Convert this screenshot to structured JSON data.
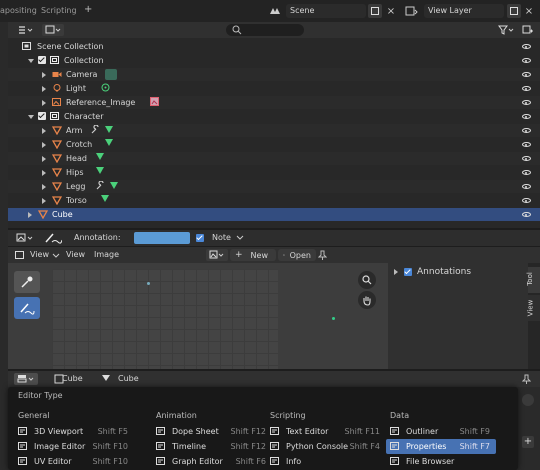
{
  "topbar": {
    "tabs": [
      "apositing",
      "Scripting"
    ],
    "add_tab": "+",
    "scene_name": "Scene",
    "view_layer": "View Layer"
  },
  "outliner": {
    "search_placeholder": "",
    "root": "Scene Collection",
    "rows": [
      {
        "label": "Collection",
        "indent": 1,
        "icon": "collection",
        "expanded": true,
        "checked": true
      },
      {
        "label": "Camera",
        "indent": 2,
        "icon": "camera",
        "extra": "camera-data"
      },
      {
        "label": "Light",
        "indent": 2,
        "icon": "light",
        "extra": "light-data"
      },
      {
        "label": "Reference_Image",
        "indent": 2,
        "icon": "image",
        "extra": "image-data"
      },
      {
        "label": "Character",
        "indent": 1,
        "icon": "collection",
        "expanded": true,
        "checked": true
      },
      {
        "label": "Arm",
        "indent": 2,
        "icon": "mesh",
        "extra": "modifier"
      },
      {
        "label": "Crotch",
        "indent": 2,
        "icon": "mesh",
        "extra": "mesh-data"
      },
      {
        "label": "Head",
        "indent": 2,
        "icon": "mesh",
        "extra": "mesh-data"
      },
      {
        "label": "Hips",
        "indent": 2,
        "icon": "mesh",
        "extra": "mesh-data"
      },
      {
        "label": "Legg",
        "indent": 2,
        "icon": "mesh",
        "extra": "modifier"
      },
      {
        "label": "Torso",
        "indent": 2,
        "icon": "mesh",
        "extra": "mesh-data"
      },
      {
        "label": "Cube",
        "indent": 1,
        "icon": "mesh",
        "selected": true
      }
    ]
  },
  "image_editor": {
    "annotation_label": "Annotation:",
    "note_label": "Note",
    "menus": [
      "View",
      "View",
      "Image"
    ],
    "new_label": "New",
    "open_label": "Open",
    "annotations_label": "Annotations",
    "side_tabs": [
      "Tool",
      "View"
    ]
  },
  "properties_header": {
    "object_name": "Cube",
    "data_name": "Cube"
  },
  "editor_type_menu": {
    "title": "Editor Type",
    "columns": [
      {
        "heading": "General",
        "items": [
          {
            "label": "3D Viewport",
            "shortcut": "Shift F5",
            "icon": "viewport-icon"
          },
          {
            "label": "Image Editor",
            "shortcut": "Shift F10",
            "icon": "image-editor-icon"
          },
          {
            "label": "UV Editor",
            "shortcut": "Shift F10",
            "icon": "uv-editor-icon"
          }
        ]
      },
      {
        "heading": "Animation",
        "items": [
          {
            "label": "Dope Sheet",
            "shortcut": "Shift F12",
            "icon": "dopesheet-icon"
          },
          {
            "label": "Timeline",
            "shortcut": "Shift F12",
            "icon": "timeline-icon"
          },
          {
            "label": "Graph Editor",
            "shortcut": "Shift F6",
            "icon": "graph-icon"
          }
        ]
      },
      {
        "heading": "Scripting",
        "items": [
          {
            "label": "Text Editor",
            "shortcut": "Shift F11",
            "icon": "text-editor-icon"
          },
          {
            "label": "Python Console",
            "shortcut": "Shift F4",
            "icon": "python-icon"
          },
          {
            "label": "Info",
            "shortcut": "",
            "icon": "info-icon"
          }
        ]
      },
      {
        "heading": "Data",
        "items": [
          {
            "label": "Outliner",
            "shortcut": "Shift F9",
            "icon": "outliner-icon"
          },
          {
            "label": "Properties",
            "shortcut": "Shift F7",
            "icon": "properties-icon",
            "active": true
          },
          {
            "label": "File Browser",
            "shortcut": "",
            "icon": "file-browser-icon"
          }
        ]
      }
    ]
  },
  "colors": {
    "selection": "#334d80",
    "active_item": "#4772b3",
    "annotation_swatch": "#5b9bd5"
  }
}
